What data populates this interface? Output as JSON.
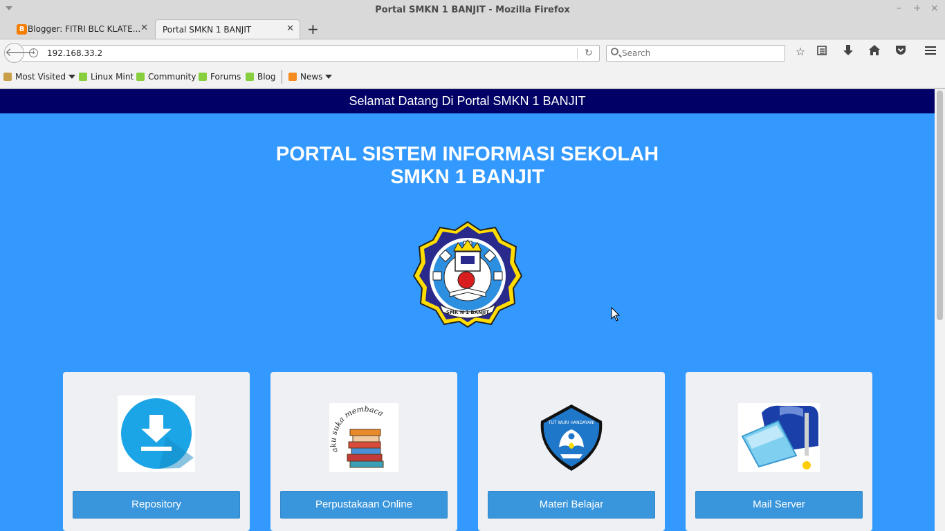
{
  "window": {
    "title": "Portal SMKN 1 BANJIT - Mozilla Firefox",
    "controls": {
      "minimize": "–",
      "maximize": "+",
      "close": "×"
    }
  },
  "tabs": [
    {
      "label": "Blogger: FITRI BLC KLATE...",
      "active": false,
      "favicon": "blogger-icon"
    },
    {
      "label": "Portal SMKN 1 BANJIT",
      "active": true
    }
  ],
  "navbar": {
    "url": "192.168.33.2",
    "search_placeholder": "Search",
    "icons": [
      "back-icon",
      "info-icon",
      "reload-icon",
      "bookmark-star-icon",
      "reading-list-icon",
      "download-icon",
      "home-icon",
      "pocket-icon",
      "hamburger-menu-icon"
    ]
  },
  "bookmarks": [
    {
      "label": "Most Visited",
      "icon": "folder",
      "dropdown": true
    },
    {
      "label": "Linux Mint",
      "icon": "mint"
    },
    {
      "label": "Community",
      "icon": "mint"
    },
    {
      "label": "Forums",
      "icon": "mint"
    },
    {
      "label": "Blog",
      "icon": "mint"
    },
    {
      "label": "News",
      "icon": "rss",
      "dropdown": true
    }
  ],
  "page": {
    "welcome": "Selamat Datang Di Portal SMKN 1 BANJIT",
    "title_line1": "PORTAL SISTEM INFORMASI SEKOLAH",
    "title_line2": "SMKN 1 BANJIT",
    "logo_text": "SMK N 1 BANJIT",
    "cards": [
      {
        "label": "Repository",
        "icon": "download-icon"
      },
      {
        "label": "Perpustakaan Online",
        "icon": "books-icon",
        "image_text": "aku suka membaca"
      },
      {
        "label": "Materi Belajar",
        "icon": "tut-wuri-handayani-icon",
        "image_text": "TUT WURI HANDAYANI"
      },
      {
        "label": "Mail Server",
        "icon": "mailbox-icon"
      }
    ]
  },
  "colors": {
    "page_bg": "#3399ff",
    "banner_bg": "#000066",
    "button_bg": "#3a96dc",
    "card_bg": "#eef0f3"
  }
}
